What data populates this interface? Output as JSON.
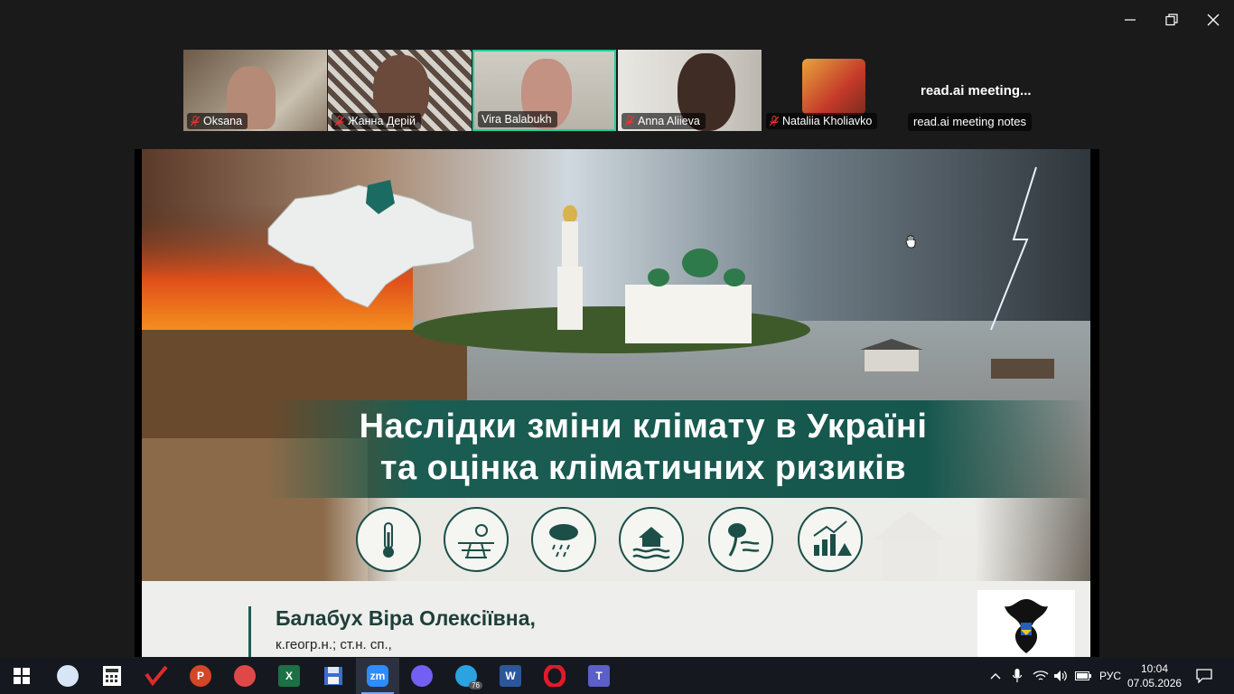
{
  "window": {
    "controls": [
      "minimize",
      "restore",
      "close"
    ]
  },
  "participants": [
    {
      "name": "Oksana",
      "muted": true
    },
    {
      "name": "Жанна Дерій",
      "muted": true
    },
    {
      "name": "Vira Balabukh",
      "muted": false,
      "active": true
    },
    {
      "name": "Anna Aliieva",
      "muted": true
    },
    {
      "name": "Nataliia Kholiavko",
      "muted": true
    }
  ],
  "readai": {
    "title": "read.ai  meeting...",
    "name": "read.ai meeting notes"
  },
  "slide": {
    "title_line1": "Наслідки зміни клімату в Україні",
    "title_line2": "та оцінка кліматичних ризиків",
    "author": "Балабух Віра Олексіївна,",
    "degree": "к.геогр.н.; ст.н. сп.,",
    "icons": [
      "thermometer-icon",
      "heat-drought-icon",
      "heavy-rain-icon",
      "flood-house-icon",
      "storm-wind-icon",
      "risk-chart-icon"
    ]
  },
  "taskbar": {
    "apps": [
      "paint-icon",
      "calculator-icon",
      "checkmark-app-icon",
      "powerpoint-icon",
      "app-icon",
      "excel-icon",
      "floppy-save-icon",
      "zoom-icon",
      "viber-icon",
      "telegram-icon",
      "word-icon",
      "opera-icon",
      "teams-icon"
    ],
    "zoom_label": "zm",
    "telegram_badge": "76",
    "language": "РУС",
    "time": "10:04",
    "date": "07.05.2026"
  }
}
